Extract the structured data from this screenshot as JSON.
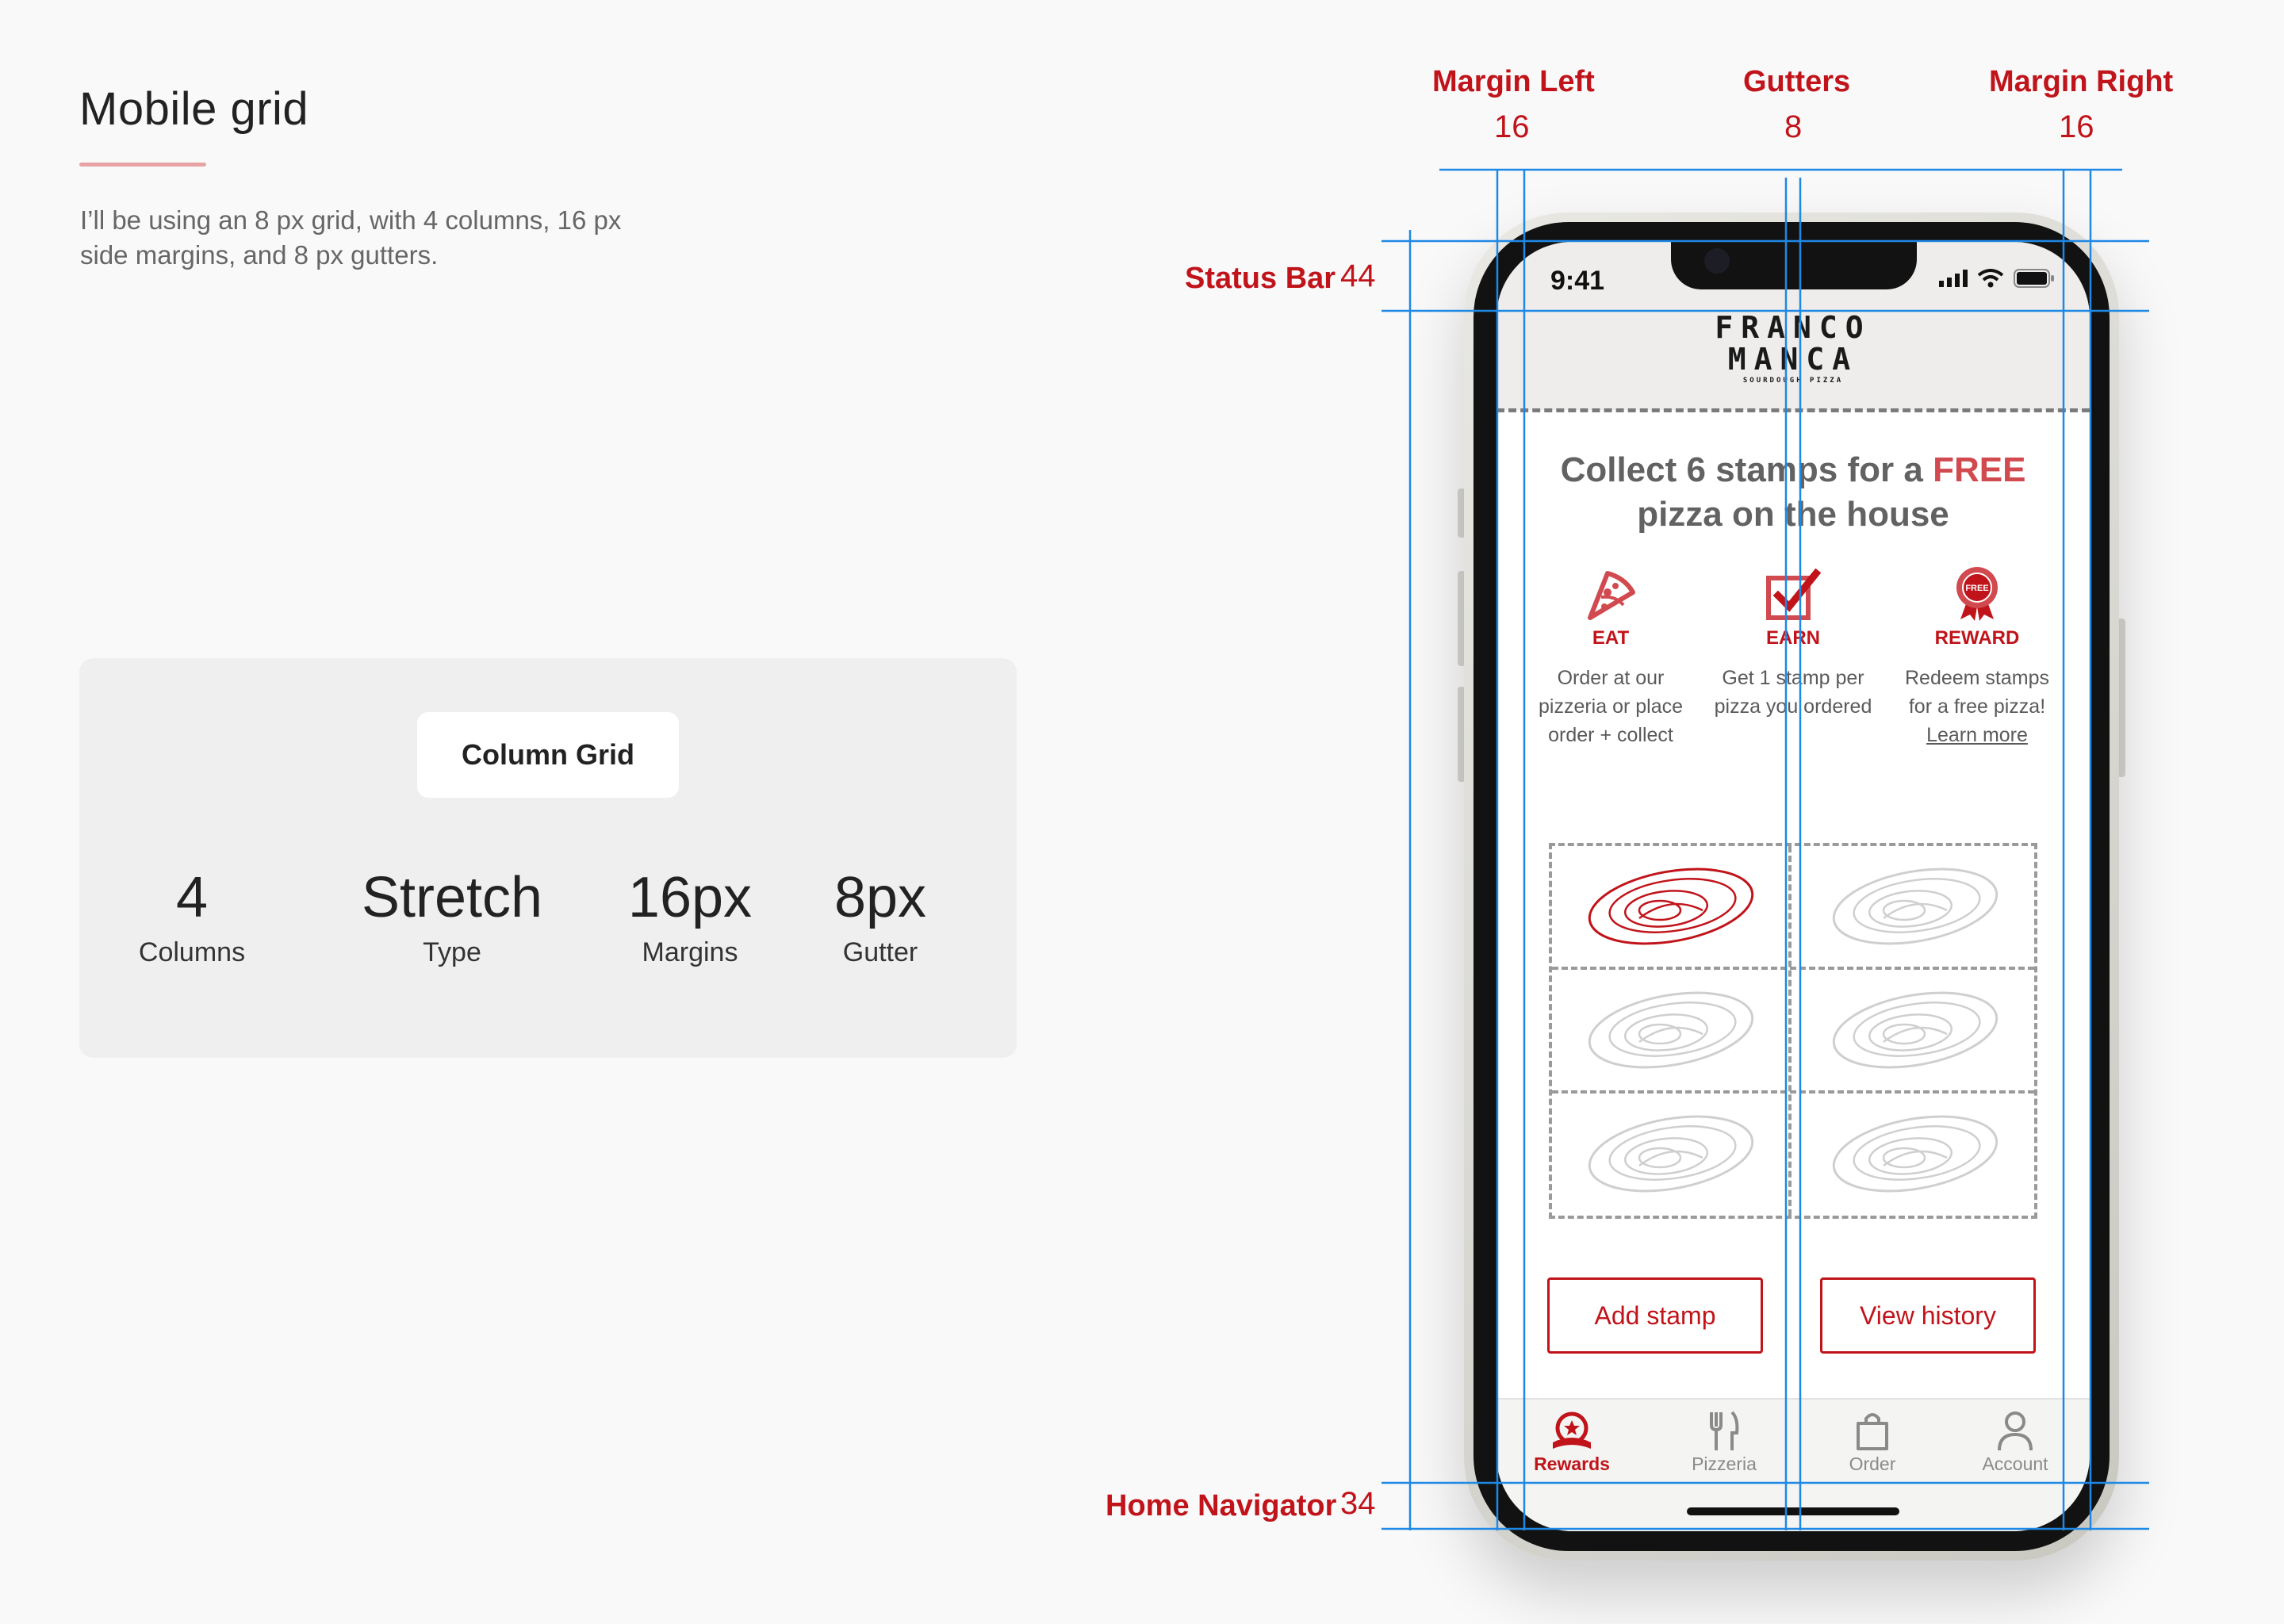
{
  "page": {
    "title": "Mobile grid",
    "intro": "I’ll be using an 8 px grid, with 4 columns, 16 px side margins, and 8 px gutters."
  },
  "grid_card": {
    "pill": "Column Grid",
    "stats": [
      {
        "value": "4",
        "label": "Columns"
      },
      {
        "value": "Stretch",
        "label": "Type"
      },
      {
        "value": "16px",
        "label": "Margins"
      },
      {
        "value": "8px",
        "label": "Gutter"
      }
    ]
  },
  "annotations": {
    "margin_left": {
      "label": "Margin Left",
      "value": "16"
    },
    "gutters": {
      "label": "Gutters",
      "value": "8"
    },
    "margin_right": {
      "label": "Margin Right",
      "value": "16"
    },
    "status_bar": {
      "label": "Status Bar",
      "value": "44"
    },
    "home_navigator": {
      "label": "Home Navigator",
      "value": "34"
    }
  },
  "phone": {
    "time": "9:41",
    "logo": {
      "line1": "FRANCO",
      "line2": "MANCA",
      "line3": "SOURDOUGH PIZZA"
    },
    "headline": {
      "part1": "Collect 6 stamps for a ",
      "highlight": "FREE",
      "part2": " pizza on the house"
    },
    "steps": [
      {
        "icon": "pizza-slice-icon",
        "label": "EAT",
        "desc": "Order at our pizzeria or place order + collect"
      },
      {
        "icon": "checkbox-icon",
        "label": "EARN",
        "desc": "Get 1 stamp per pizza you ordered"
      },
      {
        "icon": "free-badge-icon",
        "label": "REWARD",
        "desc": "Redeem stamps for a free pizza!",
        "link": "Learn more",
        "badge_text": "FREE"
      }
    ],
    "stamps_collected": 1,
    "stamps_total": 6,
    "buttons": {
      "add_stamp": "Add stamp",
      "view_history": "View history"
    },
    "tabs": [
      {
        "icon": "rewards-icon",
        "label": "Rewards",
        "active": true
      },
      {
        "icon": "fork-knife-icon",
        "label": "Pizzeria",
        "active": false
      },
      {
        "icon": "shopping-bag-icon",
        "label": "Order",
        "active": false
      },
      {
        "icon": "account-icon",
        "label": "Account",
        "active": false
      }
    ]
  },
  "colors": {
    "accent": "#c0141a",
    "free": "#d04a4f",
    "grid_line": "#1e88e5",
    "underline": "#e7a3a3"
  }
}
